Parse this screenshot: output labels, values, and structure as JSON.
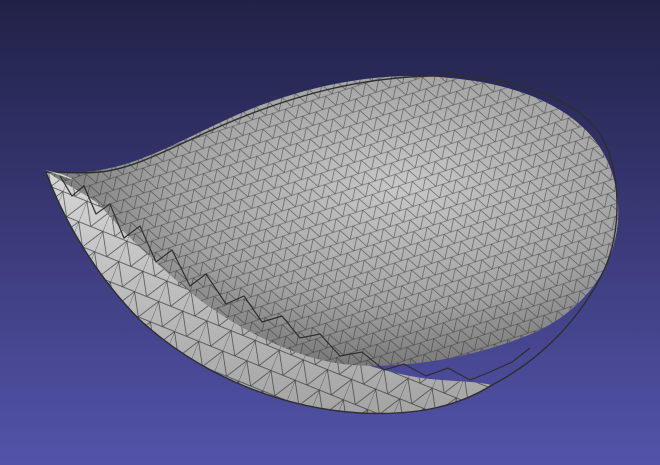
{
  "viewport": {
    "background_top": "#212147",
    "background_bottom": "#5353aa",
    "mesh_fill_light": "#c8c8c8",
    "mesh_fill_mid": "#a4a4a4",
    "mesh_fill_dark": "#7a7a7a",
    "wire_color": "#2e2e2e",
    "inner_fill": "#d6d6d6",
    "inner_shadow": "#8e8e8e"
  },
  "model": {
    "name": "",
    "render_mode": "flat-lines"
  }
}
